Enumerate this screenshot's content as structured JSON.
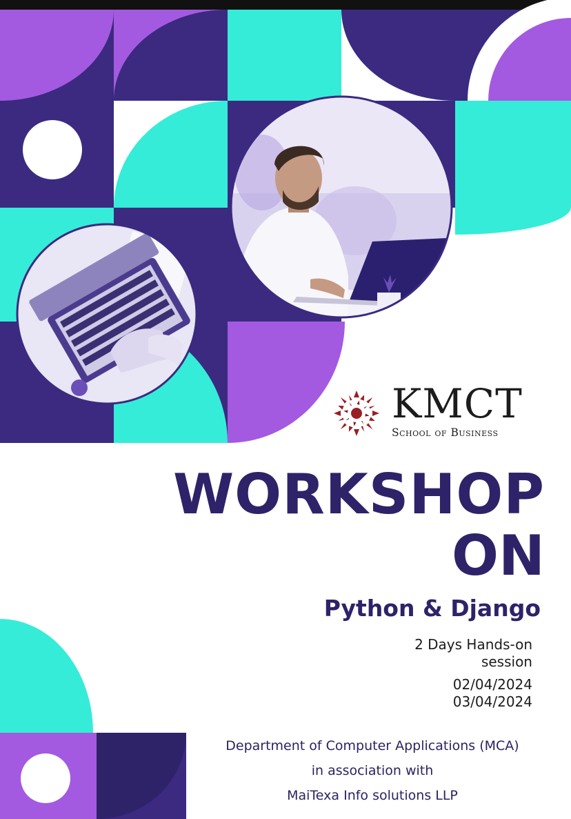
{
  "colors": {
    "purple": "#a35ae0",
    "navy": "#3b2a80",
    "teal": "#35ecd8",
    "white": "#ffffff",
    "title": "#2e2368"
  },
  "logo": {
    "name": "KMCT",
    "subtitle": "School of Business"
  },
  "title": {
    "line1": "WORKSHOP",
    "line2": "ON"
  },
  "subject": "Python & Django",
  "info": {
    "duration_line1": "2 Days Hands-on",
    "duration_line2": "session",
    "date1": "02/04/2024",
    "date2": "03/04/2024"
  },
  "footer": {
    "department": "Department of Computer Applications (MCA)",
    "association": "in association with",
    "partner": "MaiTexa Info solutions LLP"
  },
  "images": {
    "man_photo": "man-at-laptop-photo",
    "laptop_photo": "hands-on-laptop-photo"
  }
}
